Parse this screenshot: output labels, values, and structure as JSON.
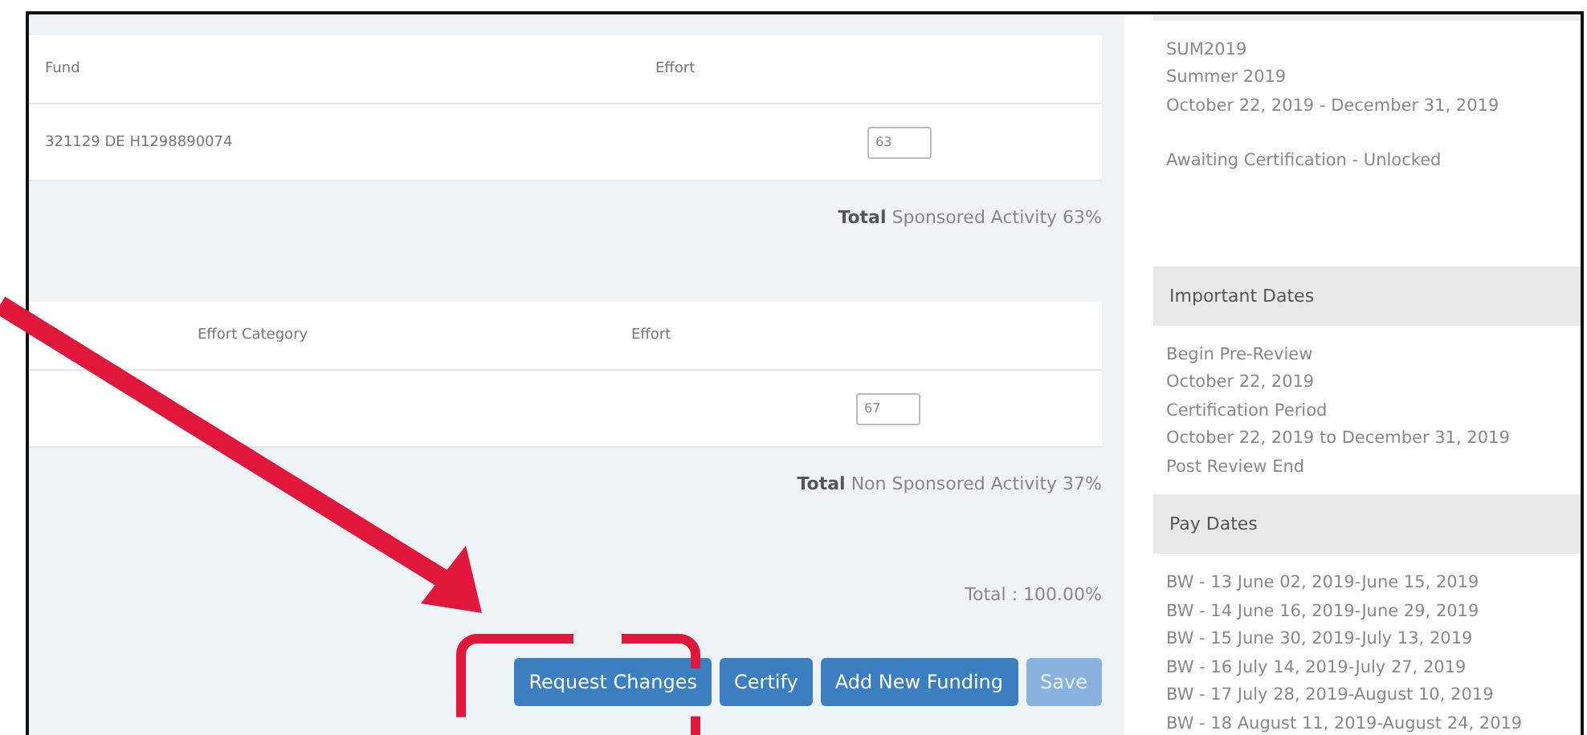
{
  "sponsored": {
    "columns": [
      "Fund",
      "Effort"
    ],
    "rows": [
      {
        "fund": "321129 DE H1298890074",
        "effort": "63"
      }
    ],
    "total": "**Total** Sponsored Activity 63%"
  },
  "non_sponsored": {
    "columns": [
      "Effort Category",
      "Effort"
    ],
    "rows": [
      {
        "effort": "67"
      }
    ],
    "total": "**Total** Non Sponsored Activity 37%"
  },
  "grand_total": "Total : 100.00%",
  "buttons": [
    {
      "label": "Request Changes",
      "disabled": false
    },
    {
      "label": "Certify",
      "disabled": false
    },
    {
      "label": "Add New Funding",
      "disabled": false
    },
    {
      "label": "Save",
      "disabled": true
    }
  ],
  "sidebar": {
    "period": [
      "SUM2019",
      "Summer 2019",
      "October 22, 2019 - December 31, 2019"
    ],
    "status": "Awaiting Certification - Unlocked",
    "sections": [
      {
        "title": "Important Dates",
        "lines": [
          "Begin Pre-Review",
          "October 22, 2019",
          "Certification Period",
          "October 22, 2019 to December 31, 2019",
          "Post Review End"
        ]
      },
      {
        "title": "Pay Dates",
        "lines": [
          "BW - 13 June 02, 2019-June 15, 2019",
          "BW - 14 June 16, 2019-June 29, 2019",
          "BW - 15 June 30, 2019-July 13, 2019",
          "BW - 16 July 14, 2019-July 27, 2019",
          "BW - 17 July 28, 2019-August 10, 2019",
          "BW - 18 August 11, 2019-August 24, 2019"
        ]
      }
    ]
  }
}
